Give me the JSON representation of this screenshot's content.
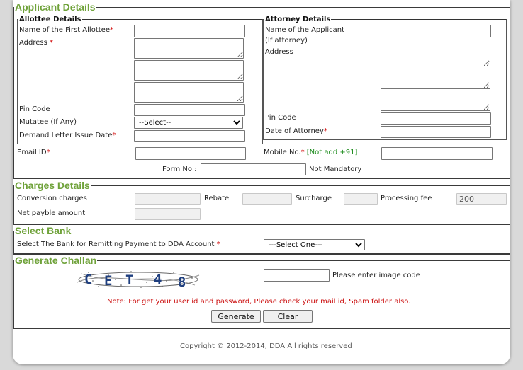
{
  "applicant_details": {
    "legend": "Applicant Details",
    "allottee": {
      "legend": "Allottee Details",
      "first_allottee_label": "Name of the First Allottee",
      "address_label": "Address",
      "pin_code_label": "Pin Code",
      "mutatee_label": "Mutatee (If Any)",
      "mutatee_value": "--Select--",
      "demand_letter_label": "Demand Letter Issue Date"
    },
    "attorney": {
      "legend": "Attorney Details",
      "applicant_label_1": "Name of the Applicant",
      "applicant_label_2": "(If attorney)",
      "address_label": "Address",
      "pin_code_label": "Pin Code",
      "date_label": "Date of Attorney"
    },
    "email_label": "Email ID",
    "mobile_label": "Mobile No.",
    "mobile_hint": "[Not add +91]",
    "form_no_label": "Form No :",
    "not_mandatory": "Not Mandatory",
    "required_mark": "*"
  },
  "charges_details": {
    "legend": "Charges Details",
    "conversion_label": "Conversion charges",
    "rebate_label": "Rebate",
    "surcharge_label": "Surcharge",
    "processing_fee_label": "Processing fee",
    "processing_fee_value": "200",
    "net_payable_label": "Net payble amount"
  },
  "select_bank": {
    "legend": "Select Bank",
    "bank_label": "Select The Bank for Remitting Payment to DDA Account",
    "bank_value": "---Select One---"
  },
  "generate_challan": {
    "legend": "Generate Challan",
    "captcha_text": "CET48",
    "captcha_hint": "Please enter image code",
    "note": "Note: For get your user id and password, Please check your mail id, Spam folder also.",
    "generate_label": "Generate",
    "clear_label": "Clear"
  },
  "footer": {
    "copyright": "Copyright © 2012-2014, DDA All rights reserved"
  }
}
